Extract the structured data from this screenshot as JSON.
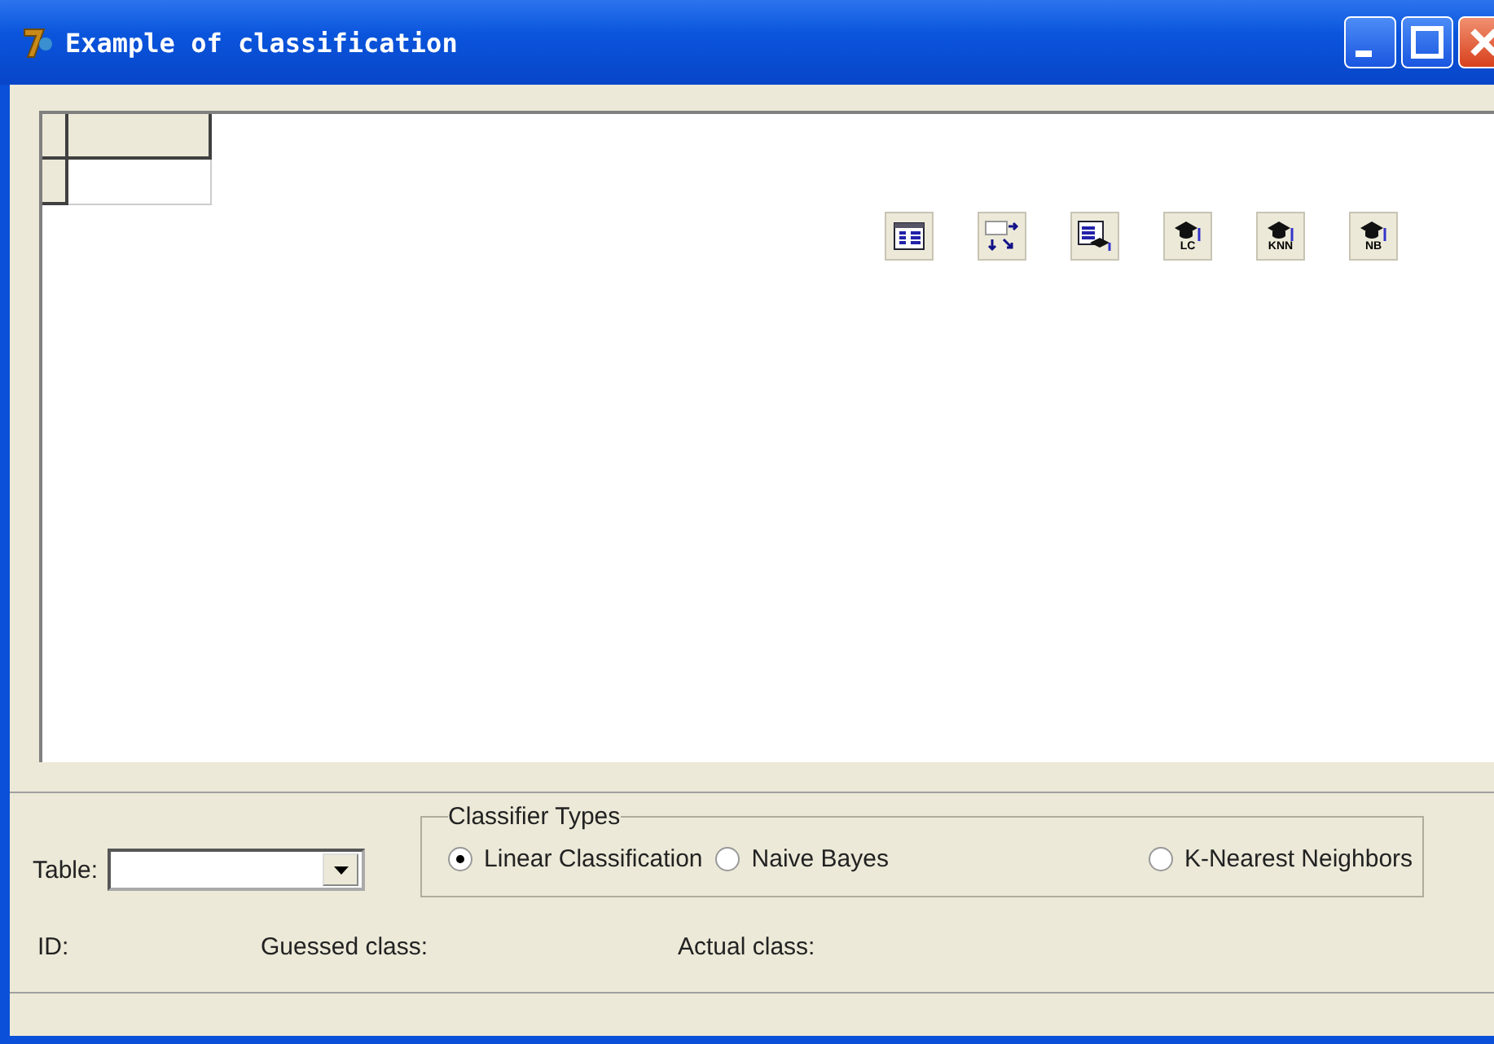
{
  "window": {
    "title": "Example of classification"
  },
  "toolbar": [
    {
      "kind": "table"
    },
    {
      "kind": "arrows"
    },
    {
      "kind": "table-cap"
    },
    {
      "kind": "cap",
      "label": "LC"
    },
    {
      "kind": "cap",
      "label": "KNN"
    },
    {
      "kind": "cap",
      "label": "NB"
    }
  ],
  "table_field": {
    "label": "Table:"
  },
  "classifier_types": {
    "title": "Classifier Types",
    "options": [
      {
        "label": "Linear Classification",
        "selected": true
      },
      {
        "label": "Naive Bayes",
        "selected": false
      },
      {
        "label": "K-Nearest Neighbors",
        "selected": false
      }
    ]
  },
  "info": [
    "ID:",
    "Guessed class:",
    "Actual class:"
  ]
}
